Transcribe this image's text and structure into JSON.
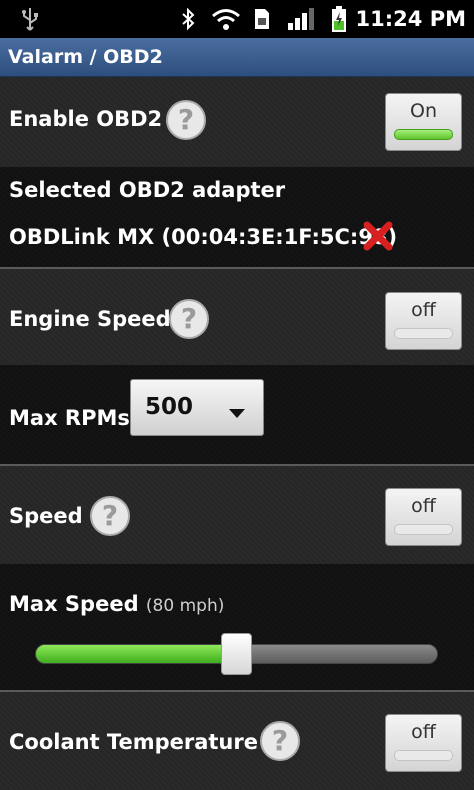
{
  "statusbar": {
    "time": "11:24 PM",
    "icons": [
      "usb-icon",
      "bluetooth-icon",
      "wifi-icon",
      "sim-icon",
      "signal-icon",
      "battery-charging-icon"
    ]
  },
  "titlebar": {
    "title": "Valarm / OBD2"
  },
  "enable_obd2": {
    "label": "Enable OBD2",
    "toggle": "On",
    "enabled": true
  },
  "adapter": {
    "label": "Selected OBD2 adapter",
    "value": "OBDLink MX (00:04:3E:1F:5C:98)",
    "remove_icon": "x-icon"
  },
  "engine_speed": {
    "label": "Engine Speed",
    "toggle": "off",
    "enabled": false
  },
  "max_rpms": {
    "label": "Max RPMs",
    "selected": "500"
  },
  "speed": {
    "label": "Speed",
    "toggle": "off",
    "enabled": false
  },
  "max_speed": {
    "label": "Max Speed",
    "unit": "(80 mph)",
    "level_fraction": 0.5
  },
  "coolant": {
    "label": "Coolant Temperature",
    "toggle": "off",
    "enabled": false
  },
  "help_glyph": "?",
  "colors": {
    "titlebar": "#3d5f90",
    "slider_fill": "#4cc322",
    "remove": "#d92020"
  }
}
